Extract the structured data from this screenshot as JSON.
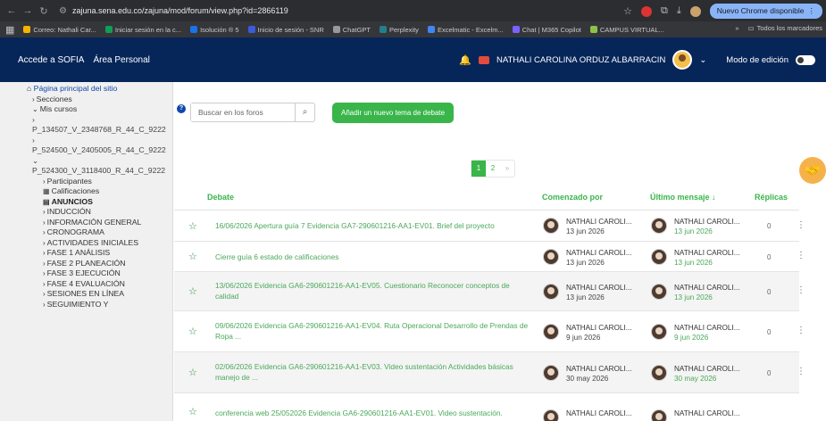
{
  "browser": {
    "url": "zajuna.sena.edu.co/zajuna/mod/forum/view.php?id=2866119",
    "update_label": "Nuevo Chrome disponible",
    "bookmarks": [
      "Correo: Nathali Car...",
      "Iniciar sesión en la c...",
      "Isolución ® 5",
      "Inicio de sesión - SNR",
      "ChatGPT",
      "Perplexity",
      "Excelmatic - Excelm...",
      "Chat | M365 Copilot",
      "CAMPUS VIRTUAL..."
    ],
    "all_bookmarks": "Todos los marcadores"
  },
  "navbar": {
    "brand": "Accede a SOFIA",
    "personal": "Área Personal",
    "user": "NATHALI CAROLINA ORDUZ ALBARRACIN",
    "edit_mode": "Modo de edición"
  },
  "sidebar": {
    "home": "Página principal del sitio",
    "sections": "Secciones",
    "my_courses": "Mis cursos",
    "courses": [
      "P_134507_V_2348768_R_44_C_9222",
      "P_524500_V_2405005_R_44_C_9222",
      "P_524300_V_3118400_R_44_C_9222"
    ],
    "items": [
      "Participantes",
      "Calificaciones",
      "ANUNCIOS",
      "INDUCCIÓN",
      "INFORMACIÓN GENERAL",
      "CRONOGRAMA",
      "ACTIVIDADES INICIALES",
      "FASE 1 ANÁLISIS",
      "FASE 2 PLANEACIÓN",
      "FASE 3 EJECUCIÓN",
      "FASE 4 EVALUACIÓN",
      "SESIONES EN LÍNEA",
      "SEGUIMIENTO Y"
    ]
  },
  "main": {
    "search_placeholder": "Buscar en los foros",
    "add_topic": "Añadir un nuevo tema de debate",
    "pages": [
      "1",
      "2",
      "»"
    ],
    "headers": {
      "debate": "Debate",
      "started_by": "Comenzado por",
      "last_post": "Último mensaje ↓",
      "replies": "Réplicas"
    },
    "rows": [
      {
        "title": "16/06/2026 Apertura guía 7 Evidencia GA7-290601216-AA1-EV01. Brief del proyecto",
        "starter": "NATHALI CAROLI...",
        "start_date": "13 jun 2026",
        "last_by": "NATHALI CAROLI...",
        "last_date": "13 jun 2026",
        "replies": "0"
      },
      {
        "title": "Cierre guía 6 estado de calificaciones",
        "starter": "NATHALI CAROLI...",
        "start_date": "13 jun 2026",
        "last_by": "NATHALI CAROLI...",
        "last_date": "13 jun 2026",
        "replies": "0"
      },
      {
        "title": "13/06/2026 Evidencia GA6-290601216-AA1-EV05. Cuestionario Reconocer conceptos de calidad",
        "starter": "NATHALI CAROLI...",
        "start_date": "13 jun 2026",
        "last_by": "NATHALI CAROLI...",
        "last_date": "13 jun 2026",
        "replies": "0"
      },
      {
        "title": "09/06/2026 Evidencia GA6-290601216-AA1-EV04. Ruta Operacional Desarrollo de Prendas de Ropa ...",
        "starter": "NATHALI CAROLI...",
        "start_date": "9 jun 2026",
        "last_by": "NATHALI CAROLI...",
        "last_date": "9 jun 2026",
        "replies": "0"
      },
      {
        "title": "02/06/2026 Evidencia GA6-290601216-AA1-EV03. Video sustentación Actividades básicas manejo de ...",
        "starter": "NATHALI CAROLI...",
        "start_date": "30 may 2026",
        "last_by": "NATHALI CAROLI...",
        "last_date": "30 may 2026",
        "replies": "0"
      },
      {
        "title": "conferencia web 25/052026 Evidencia GA6-290601216-AA1-EV01. Video sustentación.",
        "starter": "NATHALI CAROLI...",
        "start_date": "",
        "last_by": "NATHALI CAROLI...",
        "last_date": "",
        "replies": ""
      }
    ]
  }
}
